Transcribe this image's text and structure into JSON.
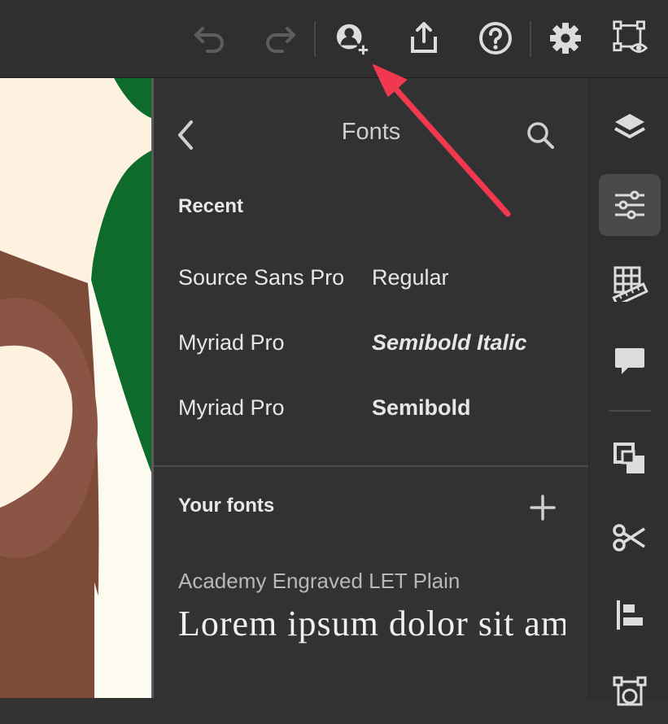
{
  "toolbar": {
    "icons": [
      "undo-icon",
      "redo-icon",
      "invite-icon",
      "share-icon",
      "help-icon",
      "settings-icon",
      "preview-icon"
    ]
  },
  "panel": {
    "title": "Fonts",
    "recent_heading": "Recent",
    "recent_fonts": [
      {
        "name": "Source Sans Pro",
        "style": "Regular"
      },
      {
        "name": "Myriad Pro",
        "style": "Semibold Italic"
      },
      {
        "name": "Myriad Pro",
        "style": "Semibold"
      }
    ],
    "your_fonts_heading": "Your fonts",
    "your_fonts": [
      {
        "name": "Academy Engraved LET Plain",
        "preview": "Lorem ipsum dolor sit amet"
      }
    ]
  },
  "rail": {
    "icons": [
      "layers-icon",
      "properties-icon",
      "grid-icon",
      "comment-icon",
      "arrange-icon",
      "cut-icon",
      "align-icon",
      "mask-icon"
    ],
    "active": "properties-icon"
  },
  "colors": {
    "background": "#323232",
    "annotation_arrow": "#f2384e",
    "canvas_green": "#0f6b2b",
    "canvas_brown": "#7e4b39",
    "canvas_cream": "#fdf1e0"
  }
}
